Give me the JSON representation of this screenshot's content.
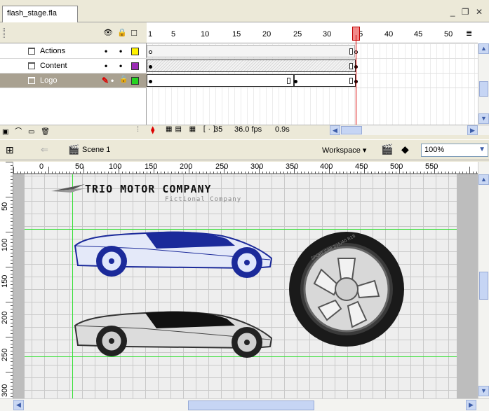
{
  "document": {
    "tab_title": "flash_stage.fla",
    "window_controls": "_ ❐ ✕"
  },
  "timeline": {
    "header_icons": {
      "eye": "👁",
      "lock": "🔒",
      "outline": "□"
    },
    "frame_numbers": [
      "1",
      "5",
      "10",
      "15",
      "20",
      "25",
      "30",
      "35",
      "40",
      "45",
      "50"
    ],
    "layers": [
      {
        "name": "Actions",
        "visible": "•",
        "locked": "•",
        "color": "#fff200",
        "selected": false
      },
      {
        "name": "Content",
        "visible": "•",
        "locked": "•",
        "color": "#9b2bb5",
        "selected": false
      },
      {
        "name": "Logo",
        "visible": "✎",
        "locked": "🔒",
        "color": "#25d321",
        "selected": true
      }
    ],
    "current_frame": "35",
    "fps": "36.0 fps",
    "elapsed": "0.9s"
  },
  "edit_bar": {
    "scene_label": "Scene 1",
    "workspace_label": "Workspace ▾",
    "zoom_value": "100%"
  },
  "rulers": {
    "top_labels": [
      "0",
      "50",
      "100",
      "150",
      "200",
      "250",
      "300",
      "350",
      "400",
      "450",
      "500",
      "550"
    ],
    "left_labels": [
      "50",
      "100",
      "150",
      "200",
      "250",
      "300"
    ]
  },
  "stage": {
    "logo_title": "TRIO MOTOR COMPANY",
    "logo_subtitle": "Fictional Company",
    "tire_text": "SPORT CAR 225/40 R18"
  },
  "colors": {
    "guide": "#38e038",
    "playhead": "#d80000",
    "car_blue": "#1b2a9a",
    "car_blue_fill": "#e0e6f8"
  }
}
